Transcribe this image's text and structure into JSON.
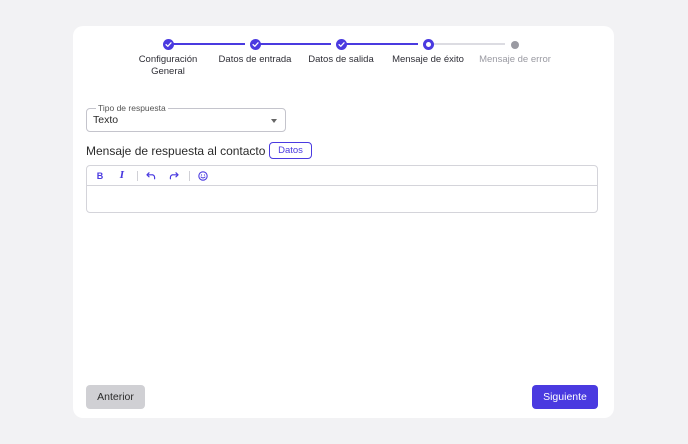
{
  "stepper": {
    "steps": [
      {
        "label_line1": "Configuración",
        "label_line2": "General",
        "state": "done"
      },
      {
        "label_line1": "Datos de entrada",
        "label_line2": "",
        "state": "done"
      },
      {
        "label_line1": "Datos de salida",
        "label_line2": "",
        "state": "done"
      },
      {
        "label_line1": "Mensaje de éxito",
        "label_line2": "",
        "state": "current"
      },
      {
        "label_line1": "Mensaje de error",
        "label_line2": "",
        "state": "todo"
      }
    ]
  },
  "form": {
    "response_type": {
      "legend": "Tipo de respuesta",
      "value": "Texto"
    },
    "message_title": "Mensaje de respuesta al contacto",
    "datos_button": "Datos",
    "editor": {
      "tools": [
        "bold-icon",
        "italic-icon",
        "undo-icon",
        "redo-icon",
        "emoji-icon"
      ],
      "bold_label": "B",
      "italic_label": "I",
      "value": ""
    }
  },
  "footer": {
    "prev_label": "Anterior",
    "next_label": "Siguiente"
  },
  "colors": {
    "accent": "#4a3ae0",
    "background": "#f2f2f4",
    "pending": "#9a9aa2"
  }
}
